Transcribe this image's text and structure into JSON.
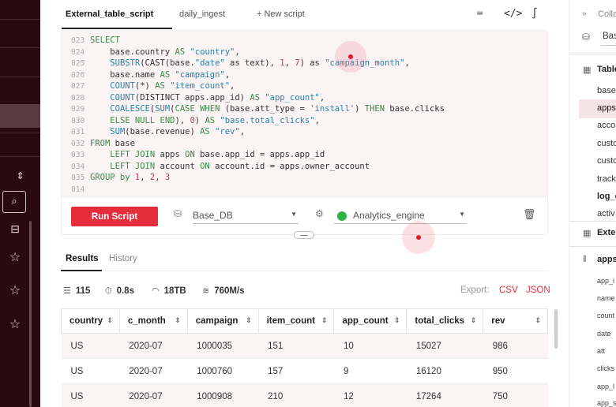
{
  "rail": {
    "icons": [
      "chevron-updown-icon",
      "search-icon",
      "collapse-box-icon",
      "star-icon",
      "star-icon",
      "star-icon"
    ]
  },
  "tabs": {
    "items": [
      {
        "label": "External_table_script",
        "active": true
      },
      {
        "label": "daily_ingest",
        "active": false
      }
    ],
    "new_label": "+ New script",
    "toolbar_icons": [
      "keyboard-icon",
      "code-icon",
      "wave-icon"
    ]
  },
  "editor": {
    "line_numbers": [
      "023",
      "024",
      "025",
      "026",
      "027",
      "028",
      "029",
      "030",
      "031",
      "032",
      "033",
      "034",
      "035",
      "014"
    ],
    "lines": [
      [
        {
          "t": "kw",
          "v": "SELECT"
        }
      ],
      [
        {
          "t": "plain",
          "v": "    base.country "
        },
        {
          "t": "kw",
          "v": "AS"
        },
        {
          "t": "plain",
          "v": " "
        },
        {
          "t": "str",
          "v": "\"country\""
        },
        {
          "t": "plain",
          "v": ","
        }
      ],
      [
        {
          "t": "plain",
          "v": "    "
        },
        {
          "t": "fn",
          "v": "SUBSTR"
        },
        {
          "t": "plain",
          "v": "(CAST(base."
        },
        {
          "t": "str",
          "v": "\"date\""
        },
        {
          "t": "plain",
          "v": " as text), "
        },
        {
          "t": "num",
          "v": "1"
        },
        {
          "t": "plain",
          "v": ", "
        },
        {
          "t": "num",
          "v": "7"
        },
        {
          "t": "plain",
          "v": ") as "
        },
        {
          "t": "str",
          "v": "\"campaign_month\""
        },
        {
          "t": "plain",
          "v": ","
        }
      ],
      [
        {
          "t": "plain",
          "v": "    base.name "
        },
        {
          "t": "kw",
          "v": "AS"
        },
        {
          "t": "plain",
          "v": " "
        },
        {
          "t": "str",
          "v": "\"campaign\""
        },
        {
          "t": "plain",
          "v": ","
        }
      ],
      [
        {
          "t": "plain",
          "v": "    "
        },
        {
          "t": "fn",
          "v": "COUNT"
        },
        {
          "t": "plain",
          "v": "(*) "
        },
        {
          "t": "kw",
          "v": "AS"
        },
        {
          "t": "plain",
          "v": " "
        },
        {
          "t": "str",
          "v": "\"item_count\""
        },
        {
          "t": "plain",
          "v": ","
        }
      ],
      [
        {
          "t": "plain",
          "v": "    "
        },
        {
          "t": "fn",
          "v": "COUNT"
        },
        {
          "t": "plain",
          "v": "(DISTINCT apps.app_id) "
        },
        {
          "t": "kw",
          "v": "AS"
        },
        {
          "t": "plain",
          "v": " "
        },
        {
          "t": "str",
          "v": "\"app_count\""
        },
        {
          "t": "plain",
          "v": ","
        }
      ],
      [
        {
          "t": "plain",
          "v": "    "
        },
        {
          "t": "fn",
          "v": "COALESCE"
        },
        {
          "t": "plain",
          "v": "("
        },
        {
          "t": "fn",
          "v": "SUM"
        },
        {
          "t": "plain",
          "v": "("
        },
        {
          "t": "kw",
          "v": "CASE WHEN"
        },
        {
          "t": "plain",
          "v": " (base.att_type = "
        },
        {
          "t": "str",
          "v": "'install'"
        },
        {
          "t": "plain",
          "v": ") "
        },
        {
          "t": "kw",
          "v": "THEN"
        },
        {
          "t": "plain",
          "v": " base.clicks"
        }
      ],
      [
        {
          "t": "plain",
          "v": "    "
        },
        {
          "t": "kw",
          "v": "ELSE NULL END"
        },
        {
          "t": "plain",
          "v": "), "
        },
        {
          "t": "num",
          "v": "0"
        },
        {
          "t": "plain",
          "v": ") "
        },
        {
          "t": "kw",
          "v": "AS"
        },
        {
          "t": "plain",
          "v": " "
        },
        {
          "t": "str",
          "v": "\"base.total_clicks\""
        },
        {
          "t": "plain",
          "v": ","
        }
      ],
      [
        {
          "t": "plain",
          "v": "    "
        },
        {
          "t": "fn",
          "v": "SUM"
        },
        {
          "t": "plain",
          "v": "(base.revenue) "
        },
        {
          "t": "kw",
          "v": "AS"
        },
        {
          "t": "plain",
          "v": " "
        },
        {
          "t": "str",
          "v": "\"rev\""
        },
        {
          "t": "plain",
          "v": ","
        }
      ],
      [
        {
          "t": "kw",
          "v": "FROM"
        },
        {
          "t": "plain",
          "v": " base"
        }
      ],
      [
        {
          "t": "plain",
          "v": "    "
        },
        {
          "t": "kw",
          "v": "LEFT JOIN"
        },
        {
          "t": "plain",
          "v": " apps "
        },
        {
          "t": "kw",
          "v": "ON"
        },
        {
          "t": "plain",
          "v": " base.app_id = apps.app_id"
        }
      ],
      [
        {
          "t": "plain",
          "v": "    "
        },
        {
          "t": "kw",
          "v": "LEFT JOIN"
        },
        {
          "t": "plain",
          "v": " account "
        },
        {
          "t": "kw",
          "v": "ON"
        },
        {
          "t": "plain",
          "v": " account.id = apps.owner_account"
        }
      ],
      [
        {
          "t": "kw",
          "v": "GROUP by"
        },
        {
          "t": "plain",
          "v": " "
        },
        {
          "t": "num",
          "v": "1"
        },
        {
          "t": "plain",
          "v": ", "
        },
        {
          "t": "num",
          "v": "2"
        },
        {
          "t": "plain",
          "v": ", "
        },
        {
          "t": "num",
          "v": "3"
        }
      ],
      []
    ]
  },
  "runbar": {
    "run_label": "Run Script",
    "database": "Base_DB",
    "engine": "Analytics_engine",
    "engine_status_color": "#2bb34a"
  },
  "results": {
    "tabs": [
      {
        "label": "Results",
        "active": true
      },
      {
        "label": "History",
        "active": false
      }
    ],
    "stats": {
      "rows": "115",
      "time": "0.8s",
      "size": "18TB",
      "speed": "760M/s"
    },
    "export_label": "Export:",
    "export_formats": [
      "CSV",
      "JSON"
    ],
    "columns": [
      "country",
      "c_month",
      "campaign",
      "item_count",
      "app_count",
      "total_clicks",
      "rev"
    ],
    "rows": [
      [
        "US",
        "2020-07",
        "1000035",
        "151",
        "10",
        "15027",
        "986"
      ],
      [
        "US",
        "2020-07",
        "1000760",
        "157",
        "9",
        "16120",
        "950"
      ],
      [
        "US",
        "2020-07",
        "1000908",
        "210",
        "12",
        "17264",
        "750"
      ]
    ]
  },
  "right_panel": {
    "collapse_label": "Colla",
    "db_label": "Base",
    "tables_label": "Table",
    "tables": [
      "base",
      "apps",
      "acco",
      "custo",
      "custo",
      "track",
      "log_e",
      "activ"
    ],
    "external_label": "Exter",
    "columns_label": "apps",
    "columns": [
      "app_i",
      "name",
      "count",
      "date",
      "att",
      "clicks",
      "app_l",
      "app_s"
    ]
  },
  "accent_color": "#e52d3b"
}
